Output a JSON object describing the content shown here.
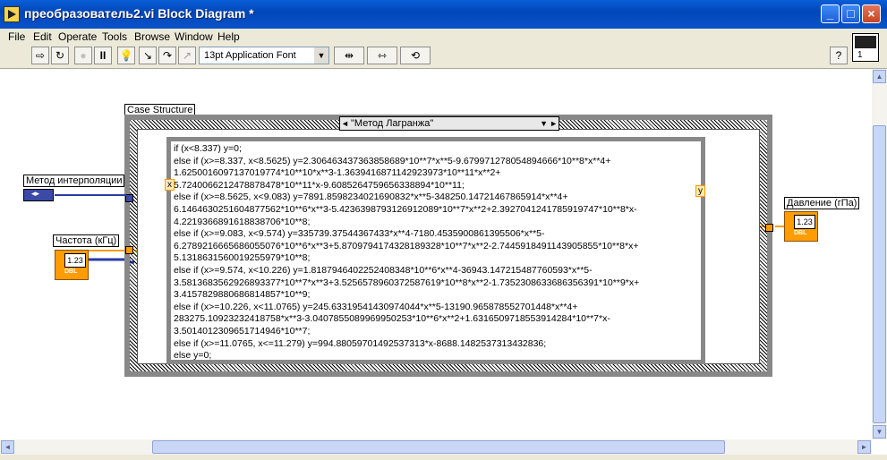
{
  "window": {
    "title": "преобразователь2.vi Block Diagram *",
    "minimize_label": "_",
    "maximize_label": "□",
    "close_label": "×"
  },
  "menu": [
    "File",
    "Edit",
    "Operate",
    "Tools",
    "Browse",
    "Window",
    "Help"
  ],
  "toolbar": {
    "font": "13pt Application Font",
    "help_label": "?",
    "run_label": "⇨",
    "run_cont_label": "↻",
    "abort_label": "●",
    "pause_label": "II",
    "highlight_label": "💡",
    "step_into_label": "↘",
    "step_over_label": "↷",
    "step_out_label": "↗",
    "align_label": "⇹",
    "distribute_label": "⇿",
    "reorder_label": "⟲"
  },
  "vi_icon": {
    "terminal_number": "1"
  },
  "case_structure": {
    "label": "Case Structure",
    "selector": "\"Метод Лагранжа\"",
    "prev_arrow": "◄",
    "next_arrow": "►",
    "dropdown_arrow": "▼",
    "formula_lines": [
      "if (x<8.337) y=0;",
      "else if (x>=8.337, x<8.5625) y=2.306463437363858689*10**7*x**5-9.679971278054894666*10**8*x**4+",
      "1.6250016097137019774*10**10*x**3-1.3639416871142923973*10**11*x**2+",
      "5.7240066212478878478*10**11*x-9.608526475965633889​4*10**11;",
      "else if (x>=8.5625, x<9.083) y=7891.8598234021690832*x**5-348250.14721467865914*x**4+",
      "6.1464630251604877562*10**6*x**3-5.4236398793126912089*10**7*x**2+2.3927041241785919747*10**8*x-",
      "4.2219366891618838706*10**8;",
      "else if (x>=9.083, x<9.574) y=335739.37544367433*x**4-7180.4535900861395506*x**5-",
      "6.2789216665686055076*10**6*x**3+5.8709794174328189328*10**7*x**2-2.7445918491143905855*10**8*x+",
      "5.1318631560019255979*10**8;",
      "else if (x>=9.574, x<10.226) y=1.8187946402252408348*10**6*x**4-36943.147215487760593*x**5-",
      "3.5813683562926893377*10**7*x**3+3.5256578960372587619*10**8*x**2-1.7352308633686356391*10**9*x+",
      "3.4157829880686814857*10**9;",
      "else if (x>=10.226, x<11.0765) y=245.63319541430974044*x**5-13190.965878552701448*x**4+",
      "283275.10923232418758*x**3-3.0407855089969950253*10**6*x**2+1.6316509718553914284*10**7*x-",
      "3.5014012309651714946*10**7;",
      "else if (x>=11.0765, x<=11.279) y=994.88059701492537313*x-8688.1482537313432836;",
      "else y=0;"
    ],
    "input_x_label": "x",
    "output_y_label": "y"
  },
  "controls": {
    "method_label": "Метод интерполяции",
    "method_enum_glyph": "◂▸",
    "freq_label": "Частота (кГц)",
    "freq_type": "DBL",
    "freq_value": "1.23"
  },
  "indicators": {
    "pressure_label": "Давление (гПа)",
    "pressure_type": "DBL",
    "pressure_value": "1.23"
  },
  "colors": {
    "numeric": "#ff9c00",
    "enum_wire": "#2a3aa8",
    "title_bar": "#0047b8"
  }
}
